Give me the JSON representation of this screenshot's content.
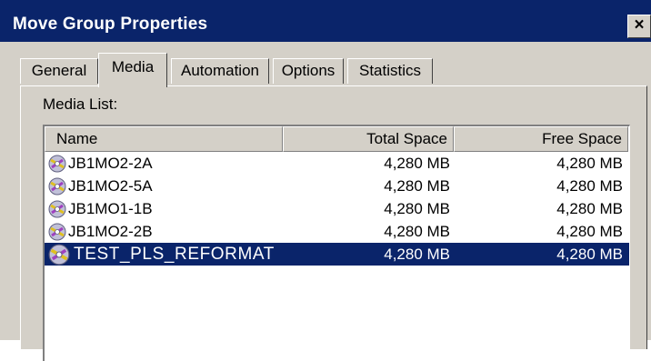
{
  "window": {
    "title": "Move Group Properties",
    "close_label": "×"
  },
  "tabs": [
    {
      "label": "General",
      "active": false
    },
    {
      "label": "Media",
      "active": true
    },
    {
      "label": "Automation",
      "active": false
    },
    {
      "label": "Options",
      "active": false
    },
    {
      "label": "Statistics",
      "active": false
    }
  ],
  "media_list": {
    "label": "Media List:",
    "columns": [
      "Name",
      "Total Space",
      "Free Space"
    ],
    "rows": [
      {
        "name": "JB1MO2-2A",
        "total": "4,280 MB",
        "free": "4,280 MB",
        "icon": "disc-icon",
        "selected": false
      },
      {
        "name": "JB1MO2-5A",
        "total": "4,280 MB",
        "free": "4,280 MB",
        "icon": "disc-icon",
        "selected": false
      },
      {
        "name": "JB1MO1-1B",
        "total": "4,280 MB",
        "free": "4,280 MB",
        "icon": "disc-icon",
        "selected": false
      },
      {
        "name": "JB1MO2-2B",
        "total": "4,280 MB",
        "free": "4,280 MB",
        "icon": "disc-icon",
        "selected": false
      },
      {
        "name": "TEST_PLS_REFORMAT",
        "total": "4,280 MB",
        "free": "4,280 MB",
        "icon": "disc-icon",
        "selected": true
      }
    ]
  },
  "colors": {
    "title_bar": "#0a246a",
    "dialog_face": "#d4d0c8",
    "selection": "#0a246a"
  }
}
